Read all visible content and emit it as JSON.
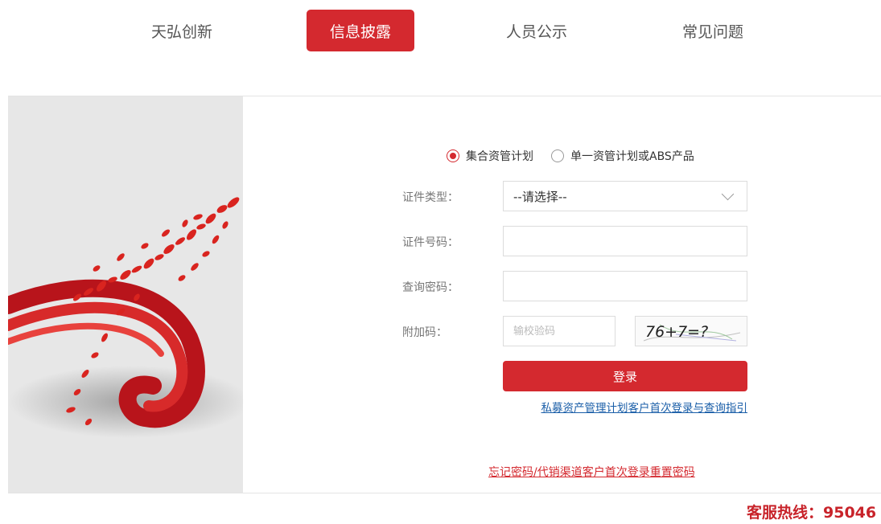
{
  "nav": {
    "items": [
      {
        "label": "天弘创新"
      },
      {
        "label": "信息披露"
      },
      {
        "label": "人员公示"
      },
      {
        "label": "常见问题"
      }
    ],
    "active_index": 1
  },
  "form": {
    "product_type": {
      "options": [
        "集合资管计划",
        "单一资管计划或ABS产品"
      ],
      "selected_index": 0
    },
    "id_type": {
      "label": "证件类型：",
      "value": "--请选择--"
    },
    "id_number": {
      "label": "证件号码：",
      "value": ""
    },
    "query_password": {
      "label": "查询密码：",
      "value": ""
    },
    "captcha": {
      "label": "附加码：",
      "placeholder": "输校验码",
      "image_text": "76+7=?"
    },
    "login_button": "登录",
    "guide_link": "私募资产管理计划客户首次登录与查询指引",
    "forgot_link": "忘记密码/代销渠道客户首次登录重置密码"
  },
  "hotline": "客服热线：95046",
  "colors": {
    "accent": "#d4292f",
    "link": "#1a5ea8"
  }
}
